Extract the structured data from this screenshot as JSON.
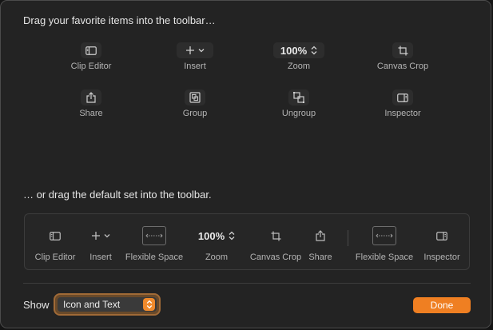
{
  "palette": {
    "title": "Drag your favorite items into the toolbar…",
    "items": [
      {
        "label": "Clip Editor",
        "icon": "sidebar-right-icon"
      },
      {
        "label": "Insert",
        "icon": "plus-chevron-icon"
      },
      {
        "label": "Zoom",
        "value": "100%",
        "icon": "stepper-icon"
      },
      {
        "label": "Canvas Crop",
        "icon": "crop-icon"
      },
      {
        "label": "Share",
        "icon": "share-icon"
      },
      {
        "label": "Group",
        "icon": "group-icon"
      },
      {
        "label": "Ungroup",
        "icon": "ungroup-icon"
      },
      {
        "label": "Inspector",
        "icon": "inspector-icon"
      }
    ]
  },
  "default_set": {
    "title": "… or drag the default set into the toolbar.",
    "items": [
      {
        "label": "Clip Editor",
        "icon": "sidebar-icon"
      },
      {
        "label": "Insert",
        "icon": "plus-chevron-icon"
      },
      {
        "label": "Flexible Space",
        "icon": "flexible-space-icon"
      },
      {
        "label": "Zoom",
        "value": "100%",
        "icon": "stepper-icon"
      },
      {
        "label": "Canvas Crop",
        "icon": "crop-icon"
      },
      {
        "label": "Share",
        "icon": "share-icon"
      },
      {
        "label": "Flexible Space",
        "icon": "flexible-space-icon"
      },
      {
        "label": "Inspector",
        "icon": "inspector-icon"
      }
    ]
  },
  "footer": {
    "show_label": "Show",
    "show_value": "Icon and Text",
    "done_label": "Done"
  },
  "colors": {
    "accent": "#ef7f22",
    "background": "#232323",
    "text": "#e6e6e6"
  }
}
